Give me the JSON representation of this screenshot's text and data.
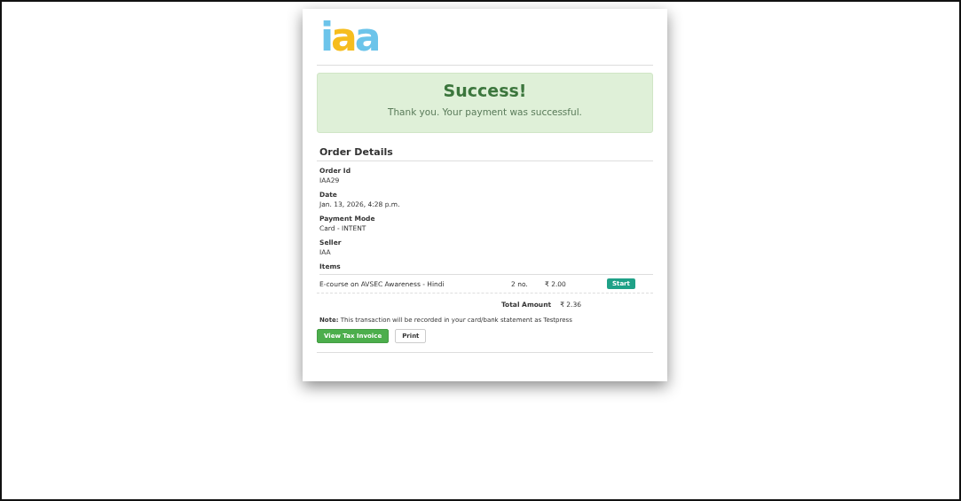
{
  "logo": {
    "text": "iaa"
  },
  "alert": {
    "title": "Success!",
    "message": "Thank you. Your payment was successful."
  },
  "order": {
    "heading": "Order Details",
    "fields": [
      {
        "label": "Order Id",
        "value": "IAA29"
      },
      {
        "label": "Date",
        "value": "Jan. 13, 2026, 4:28 p.m."
      },
      {
        "label": "Payment Mode",
        "value": "Card - INTENT"
      },
      {
        "label": "Seller",
        "value": "IAA"
      }
    ],
    "items_label": "Items",
    "items": [
      {
        "name": "E-course on AVSEC Awareness - Hindi",
        "quantity": "2 no.",
        "price": "₹ 2.00",
        "action": "Start"
      }
    ],
    "total_label": "Total Amount",
    "total": "₹ 2.36",
    "note": "**Note:** This transaction will be recorded in your card/bank statement as Testpress",
    "buttons": [
      {
        "label": "View Tax Invoice",
        "kind": "primary"
      },
      {
        "label": "Print",
        "kind": "default"
      }
    ]
  }
}
